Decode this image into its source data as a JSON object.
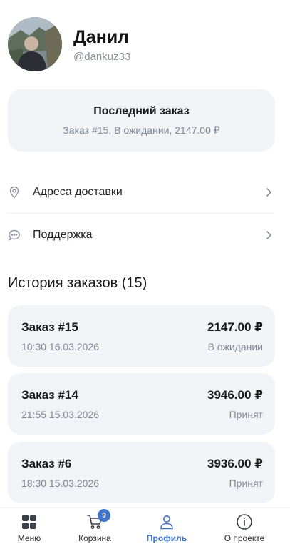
{
  "profile": {
    "name": "Данил",
    "handle": "@dankuz33"
  },
  "last_order": {
    "title": "Последний заказ",
    "summary": "Заказ #15, В ожидании, 2147.00 ₽"
  },
  "menu": [
    {
      "label": "Адреса доставки",
      "icon": "location-pin-icon"
    },
    {
      "label": "Поддержка",
      "icon": "chat-bubble-icon"
    }
  ],
  "history": {
    "title": "История заказов (15)",
    "orders": [
      {
        "number": "Заказ #15",
        "datetime": "10:30 16.03.2026",
        "total": "2147.00 ₽",
        "status": "В ожидании"
      },
      {
        "number": "Заказ #14",
        "datetime": "21:55 15.03.2026",
        "total": "3946.00 ₽",
        "status": "Принят"
      },
      {
        "number": "Заказ #6",
        "datetime": "18:30 15.03.2026",
        "total": "3936.00 ₽",
        "status": "Принят"
      }
    ]
  },
  "nav": {
    "items": [
      {
        "label": "Меню",
        "icon": "grid-icon"
      },
      {
        "label": "Корзина",
        "icon": "cart-icon",
        "badge": "9"
      },
      {
        "label": "Профиль",
        "icon": "user-icon",
        "active": true
      },
      {
        "label": "О проекте",
        "icon": "info-icon"
      }
    ]
  },
  "colors": {
    "accent": "#3f73c9",
    "card_background": "#f1f3f6",
    "muted_text": "#808792"
  }
}
